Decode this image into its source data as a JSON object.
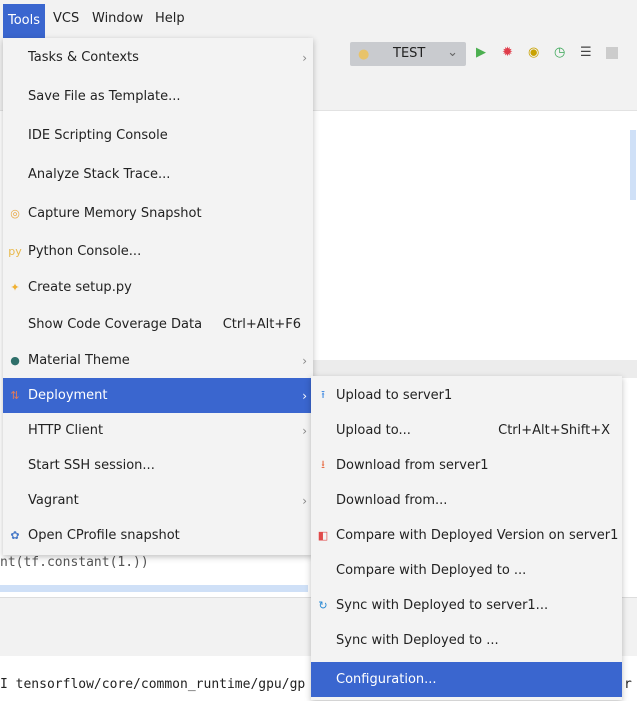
{
  "menubar": {
    "items": [
      {
        "label": "Tools",
        "active": true
      },
      {
        "label": "VCS"
      },
      {
        "label": "Window"
      },
      {
        "label": "Help"
      }
    ]
  },
  "toolbar": {
    "run_config": "TEST",
    "icons": [
      "run-icon",
      "debug-icon",
      "coverage-icon",
      "profile-icon",
      "run-list-icon",
      "stop-icon"
    ]
  },
  "tools_menu": [
    {
      "label": "Tasks & Contexts",
      "submenu": true
    },
    {
      "label": "Save File as Template..."
    },
    {
      "label": "IDE Scripting Console"
    },
    {
      "label": "Analyze Stack Trace..."
    },
    {
      "label": "Capture Memory Snapshot",
      "icon": "memory-icon"
    },
    {
      "label": "Python Console...",
      "icon": "python-console-icon"
    },
    {
      "label": "Create setup.py",
      "icon": "python-icon"
    },
    {
      "label": "Show Code Coverage Data",
      "shortcut": "Ctrl+Alt+F6"
    },
    {
      "label": "Material Theme",
      "icon": "material-theme-icon",
      "submenu": true
    },
    {
      "label": "Deployment",
      "icon": "deployment-icon",
      "submenu": true,
      "selected": true
    },
    {
      "label": "HTTP Client",
      "submenu": true
    },
    {
      "label": "Start SSH session..."
    },
    {
      "label": "Vagrant",
      "submenu": true
    },
    {
      "label": "Open CProfile snapshot",
      "icon": "cprofile-icon"
    }
  ],
  "deployment_menu": [
    {
      "label": "Upload to server1",
      "icon": "upload-icon"
    },
    {
      "label": "Upload to...",
      "shortcut": "Ctrl+Alt+Shift+X"
    },
    {
      "label": "Download from server1",
      "icon": "download-icon"
    },
    {
      "label": "Download from..."
    },
    {
      "label": "Compare with Deployed Version on server1",
      "icon": "compare-icon"
    },
    {
      "label": "Compare with Deployed to ..."
    },
    {
      "label": "Sync with Deployed to server1...",
      "icon": "sync-icon"
    },
    {
      "label": "Sync with Deployed to ..."
    },
    {
      "label": "Configuration...",
      "selected": true
    }
  ],
  "editor": {
    "code_line": "nt(tf.constant(1.))"
  },
  "console": {
    "line": "I tensorflow/core/common_runtime/gpu/gp",
    "line_end": "r"
  },
  "colors": {
    "accent": "#3a66cf",
    "menu_bg": "#f3f3f3"
  }
}
